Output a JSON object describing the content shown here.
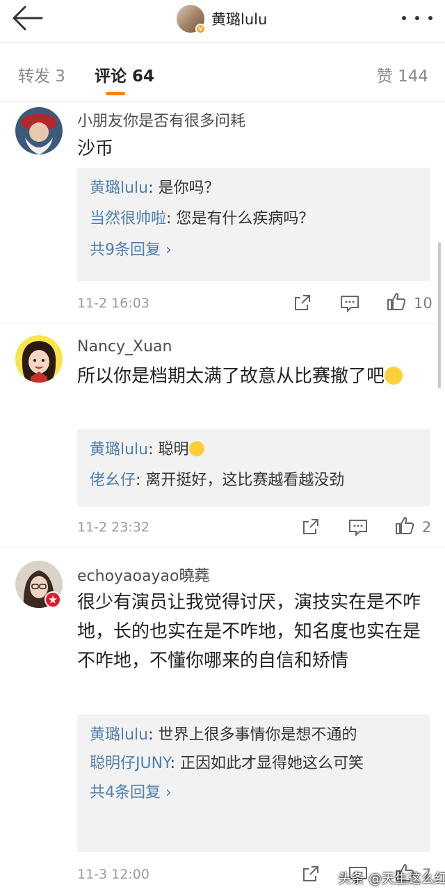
{
  "header": {
    "title": "黄璐lulu"
  },
  "tabs": {
    "repost": "转发 3",
    "comments": "评论 64",
    "likes": "赞 144"
  },
  "comments": [
    {
      "name": "小朋友你是否有很多问耗",
      "text": "沙币",
      "replies": [
        {
          "name": "黄璐lulu",
          "text": ": 是你吗？"
        },
        {
          "name": "当然很帅啦",
          "text": ": 您是有什么疾病吗？"
        }
      ],
      "more_replies": "共9条回复 ›",
      "time": "11-2 16:03",
      "likes": "10"
    },
    {
      "name": "Nancy_Xuan",
      "text": "所以你是档期太满了故意从比赛撤了吧",
      "replies": [
        {
          "name": "黄璐lulu",
          "text": ": 聪明"
        },
        {
          "name": "佬幺仔",
          "text": ": 离开挺好，这比赛越看越没劲"
        }
      ],
      "time": "11-2 23:32",
      "likes": "2"
    },
    {
      "name": "echoyaoayao曉蕘",
      "text": "很少有演员让我觉得讨厌，演技实在是不咋地，长的也实在是不咋地，知名度也实在是不咋地，不懂你哪来的自信和矫情",
      "replies": [
        {
          "name": "黄璐lulu",
          "text": ": 世界上很多事情你是想不通的"
        },
        {
          "name": "聪明仔JUNY",
          "text": ": 正因如此才显得她这么可笑"
        }
      ],
      "more_replies": "共4条回复 ›",
      "time": "11-3 12:00",
      "likes": "7"
    }
  ],
  "watermark": "头条 @天生这么红"
}
